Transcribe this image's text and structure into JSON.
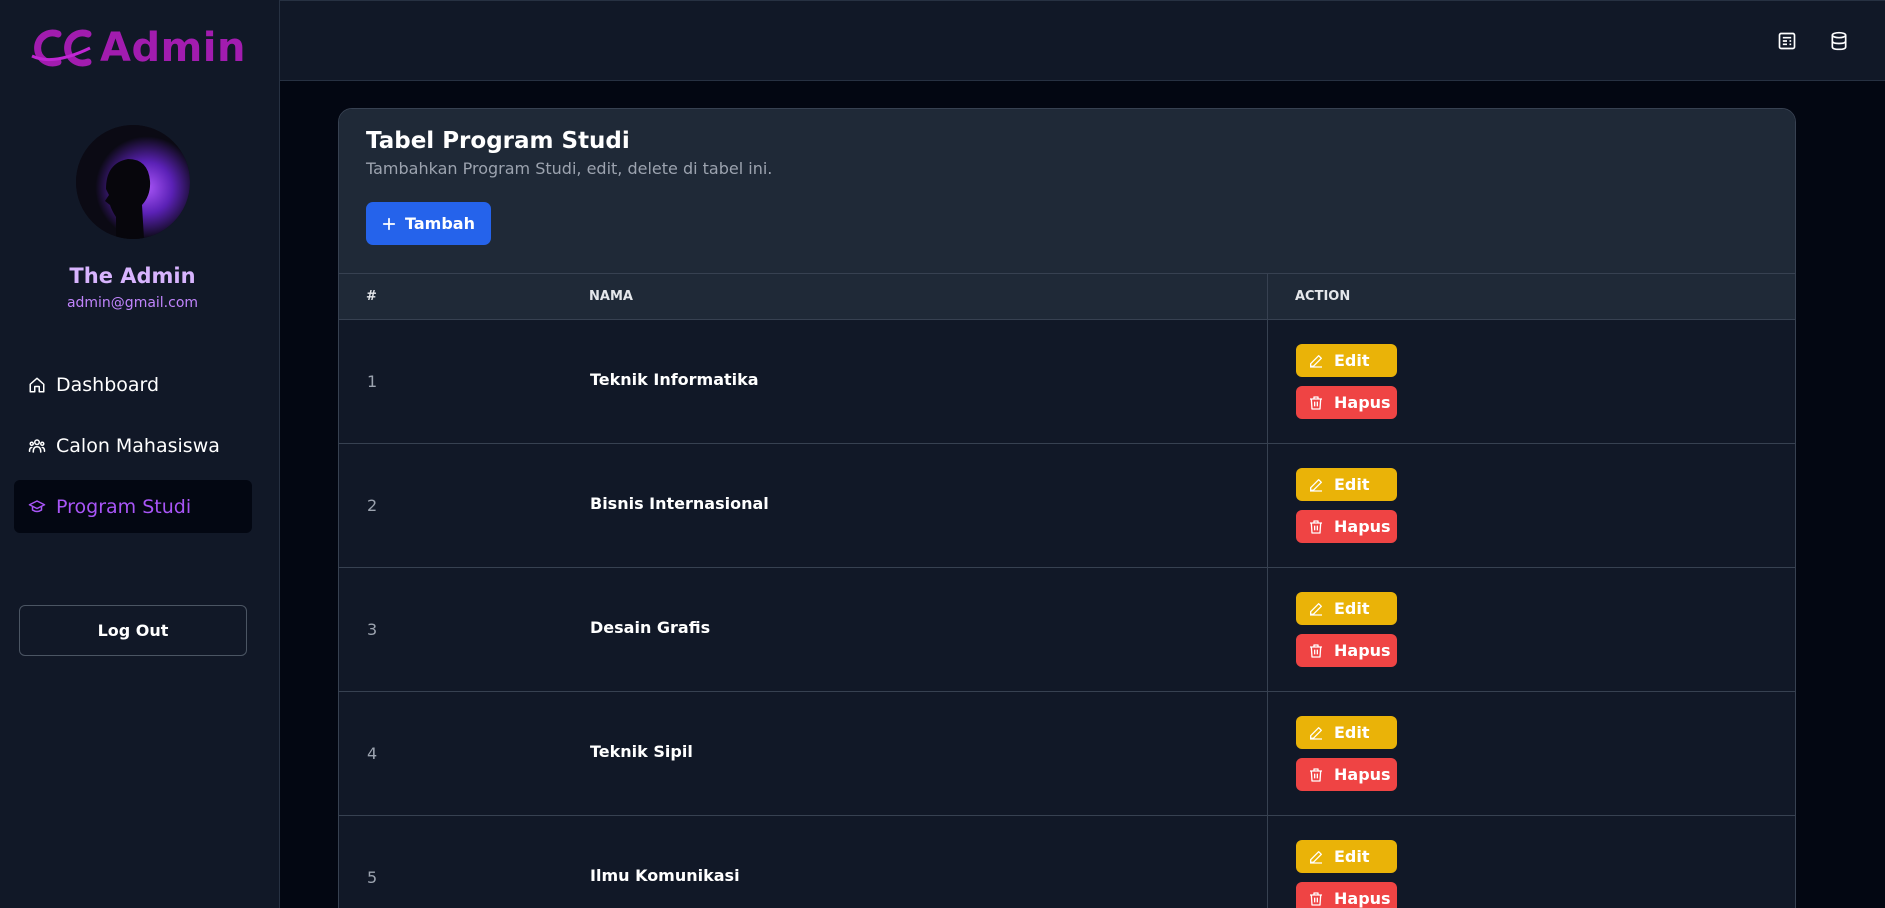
{
  "brand": {
    "logo_text": "Admin",
    "color": "#a21caf"
  },
  "profile": {
    "name": "The Admin",
    "email": "admin@gmail.com"
  },
  "nav": {
    "items": [
      {
        "label": "Dashboard",
        "icon": "home-icon",
        "active": false
      },
      {
        "label": "Calon Mahasiswa",
        "icon": "users-icon",
        "active": false
      },
      {
        "label": "Program Studi",
        "icon": "graduation-cap-icon",
        "active": true
      }
    ],
    "logout_label": "Log Out"
  },
  "topbar": {
    "icons": [
      "table-icon",
      "database-icon"
    ]
  },
  "card": {
    "title": "Tabel Program Studi",
    "subtitle": "Tambahkan Program Studi, edit, delete di tabel ini.",
    "add_label": "Tambah"
  },
  "table": {
    "headers": [
      "#",
      "NAMA",
      "ACTION"
    ],
    "rows": [
      {
        "num": "1",
        "name": "Teknik Informatika"
      },
      {
        "num": "2",
        "name": "Bisnis Internasional"
      },
      {
        "num": "3",
        "name": "Desain Grafis"
      },
      {
        "num": "4",
        "name": "Teknik Sipil"
      },
      {
        "num": "5",
        "name": "Ilmu Komunikasi"
      }
    ],
    "edit_label": "Edit",
    "delete_label": "Hapus"
  },
  "colors": {
    "accent": "#a855f7",
    "primary": "#2563eb",
    "edit": "#eab308",
    "delete": "#ef4444"
  }
}
